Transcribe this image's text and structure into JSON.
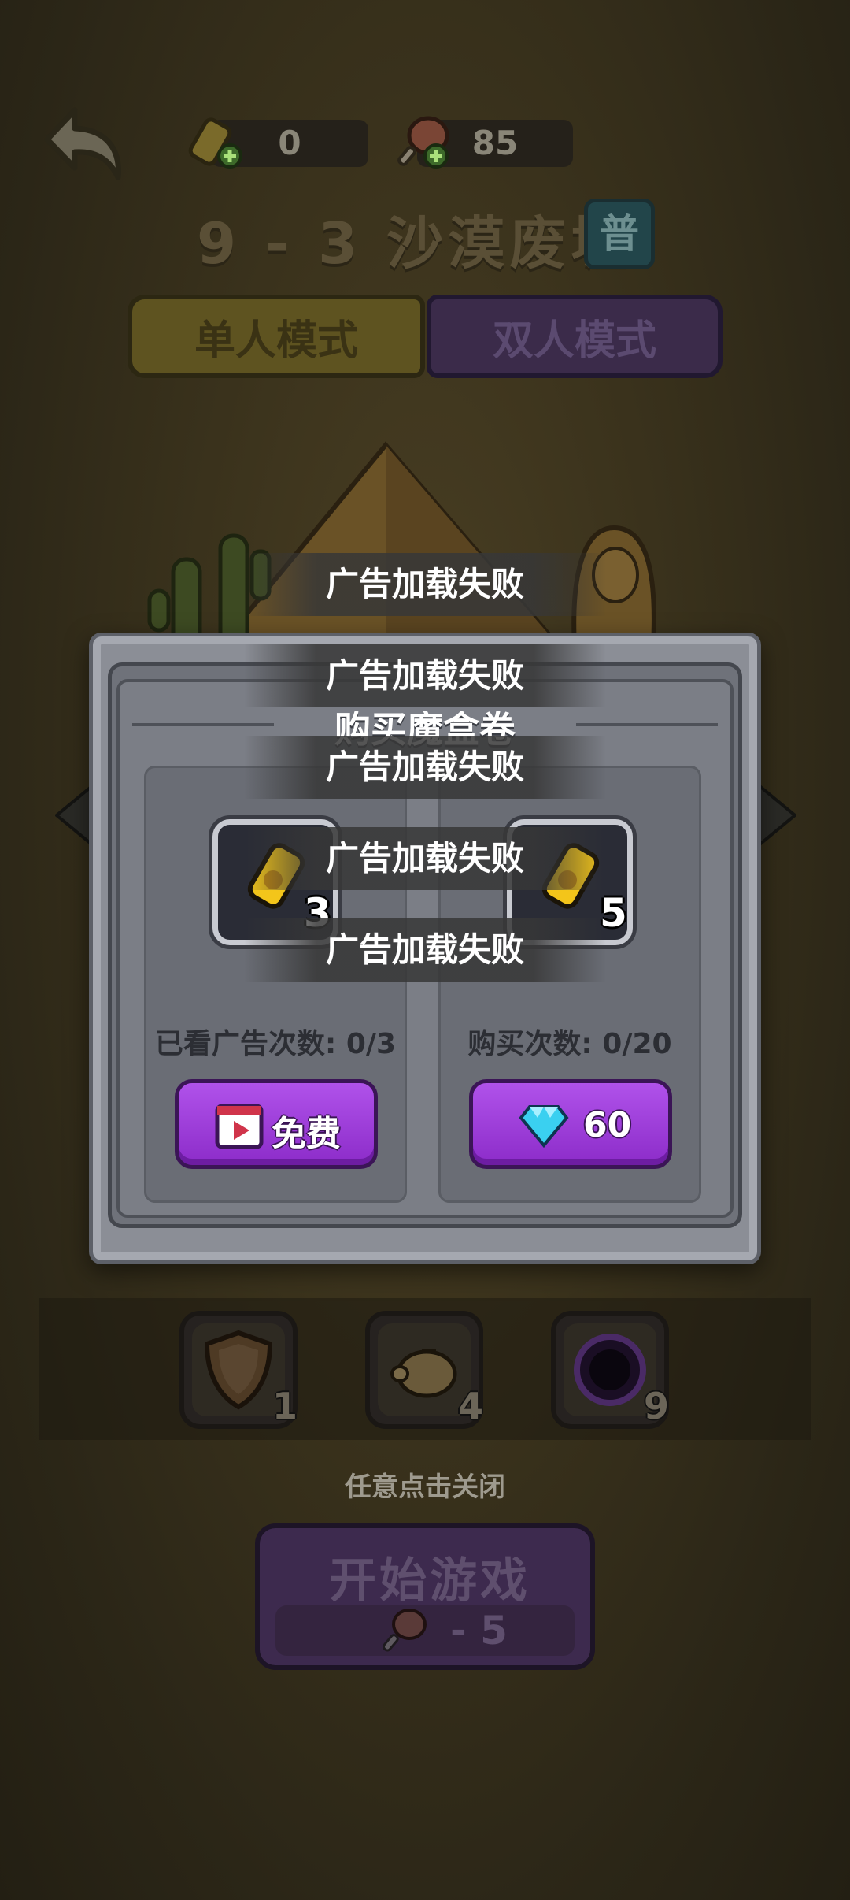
{
  "topbar": {
    "tickets_value": "0",
    "stamina_value": "85"
  },
  "level": {
    "title": "9 - 3 沙漠废墟",
    "difficulty": "普"
  },
  "modes": {
    "single": "单人模式",
    "double": "双人模式"
  },
  "dialog": {
    "title": "购买魔盒卷",
    "left_card": {
      "item_count": "3",
      "label": "已看广告次数: 0/3",
      "button_label": "免费"
    },
    "right_card": {
      "item_count": "5",
      "label": "购买次数: 0/20",
      "button_label": "60"
    }
  },
  "toasts": [
    "广告加载失败",
    "广告加载失败",
    "广告加载失败",
    "广告加载失败",
    "广告加载失败"
  ],
  "boosters": [
    {
      "icon": "shield-icon",
      "count": "1"
    },
    {
      "icon": "piggy-bank-icon",
      "count": "4"
    },
    {
      "icon": "black-hole-icon",
      "count": "9"
    }
  ],
  "hint": "任意点击关闭",
  "start": {
    "label": "开始游戏",
    "cost": "- 5"
  },
  "colors": {
    "accent_purple": "#9b3ddb",
    "gem_blue": "#3ad0f0",
    "ticket_yellow": "#f3c51a"
  }
}
